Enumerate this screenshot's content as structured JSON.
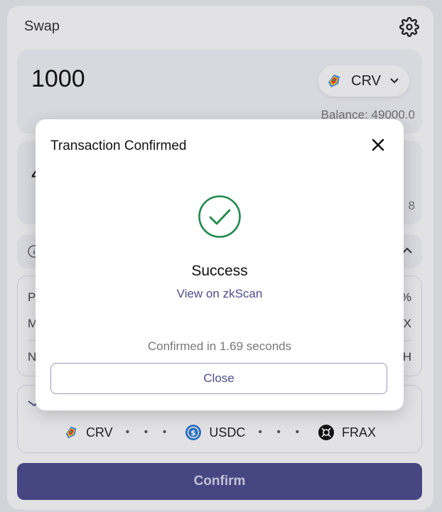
{
  "swap": {
    "title": "Swap",
    "settings_icon": "gear-icon",
    "input": {
      "amount": "1000",
      "token_symbol": "CRV",
      "balance": "Balance: 49000.0"
    },
    "output": {
      "visible_fragment_left": "4",
      "visible_fragment_right": "8"
    },
    "details": {
      "rows": [
        {
          "label": "P",
          "value": "%"
        },
        {
          "label": "M",
          "value": "X"
        },
        {
          "label": "N",
          "value": "H"
        }
      ]
    },
    "route": {
      "steps": [
        {
          "symbol": "CRV",
          "icon": "crv-token-icon"
        },
        {
          "symbol": "USDC",
          "icon": "usdc-token-icon"
        },
        {
          "symbol": "FRAX",
          "icon": "frax-token-icon"
        }
      ],
      "separator": "• • •"
    },
    "confirm_label": "Confirm"
  },
  "modal": {
    "title": "Transaction Confirmed",
    "status": "Success",
    "link_text": "View on zkScan",
    "confirmed_text": "Confirmed in 1.69 seconds",
    "close_label": "Close"
  },
  "colors": {
    "accent": "#4a4a8a",
    "link": "#4d4d8f",
    "success": "#1f8a4c"
  }
}
